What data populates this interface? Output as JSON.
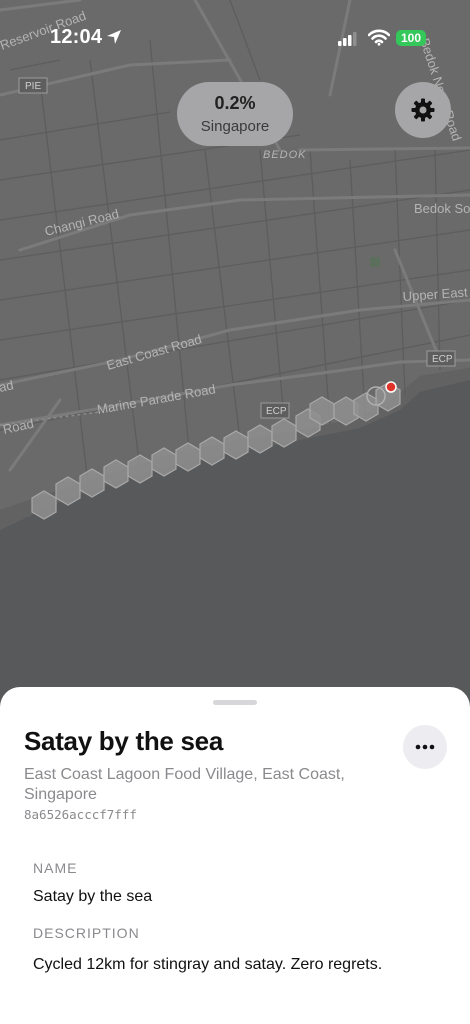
{
  "status_bar": {
    "time": "12:04",
    "battery": "100"
  },
  "coverage": {
    "percent": "0.2%",
    "region": "Singapore"
  },
  "map": {
    "road_labels": [
      "Reservoir Road",
      "Bedok North Road",
      "Changi Road",
      "Bedok So",
      "Upper East",
      "East Coast Road",
      "Marine Parade Road",
      "Road",
      "ad"
    ],
    "area_labels": [
      "BEDOK"
    ],
    "shields": [
      "PIE",
      "ECP",
      "ECP"
    ]
  },
  "sheet": {
    "title": "Satay by the sea",
    "address": "East Coast Lagoon Food Village, East Coast, Singapore",
    "hash": "8a6526acccf7fff",
    "name_label": "NAME",
    "name_value": "Satay by the sea",
    "description_label": "DESCRIPTION",
    "description_value": "Cycled 12km for stingray and satay. Zero regrets."
  },
  "colors": {
    "land": "#6a6a6a",
    "sea": "#58595b",
    "sheet": "#ffffff",
    "pin": "#e0332a",
    "battery": "#34c759"
  },
  "icons": [
    "location-arrow-icon",
    "cellular-signal-icon",
    "wifi-icon",
    "gear-icon",
    "ellipsis-icon"
  ]
}
